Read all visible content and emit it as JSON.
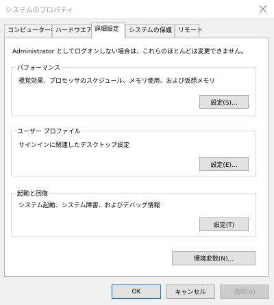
{
  "window": {
    "title": "システムのプロパティ"
  },
  "tabs": [
    {
      "label": "コンピューター名"
    },
    {
      "label": "ハードウエア"
    },
    {
      "label": "詳細設定"
    },
    {
      "label": "システムの保護"
    },
    {
      "label": "リモート"
    }
  ],
  "notice": "Administrator としてログオンしない場合は、これらのほとんどは変更できません。",
  "performance": {
    "title": "パフォーマンス",
    "description": "視覚効果、プロセッサのスケジュール、メモリ使用、および仮想メモリ",
    "button": "設定(S)..."
  },
  "user_profile": {
    "title": "ユーザー プロファイル",
    "description": "サインインに関連したデスクトップ設定",
    "button": "設定(E)..."
  },
  "startup_recovery": {
    "title": "起動と回復",
    "description": "システム起動、システム障害、およびデバッグ情報",
    "button": "設定(T)"
  },
  "env_button": "環境変数(N)...",
  "footer": {
    "ok": "OK",
    "cancel": "キャンセル",
    "apply": "適用(A)"
  }
}
